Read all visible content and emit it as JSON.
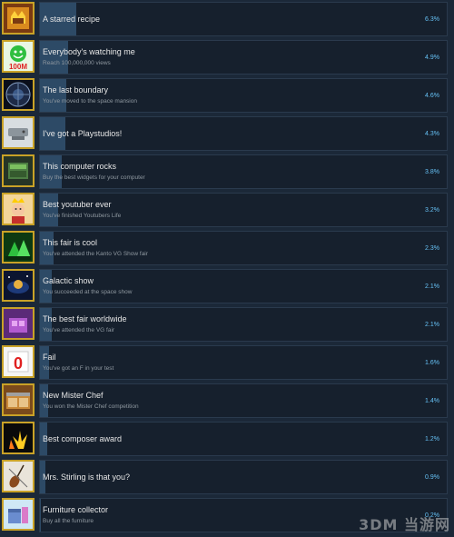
{
  "achievements": [
    {
      "title": "A starred recipe",
      "desc": "",
      "percent": "6.3%",
      "value": 6.3,
      "icon": "crown-chef-icon"
    },
    {
      "title": "Everybody's watching me",
      "desc": "Reach 100,000,000 views",
      "percent": "4.9%",
      "value": 4.9,
      "icon": "100m-smiley-icon",
      "icon_text": "100M"
    },
    {
      "title": "The last boundary",
      "desc": "You've moved to the space mansion",
      "percent": "4.6%",
      "value": 4.6,
      "icon": "space-mansion-icon"
    },
    {
      "title": "I've got a Playstudios!",
      "desc": "",
      "percent": "4.3%",
      "value": 4.3,
      "icon": "console-icon"
    },
    {
      "title": "This computer rocks",
      "desc": "Buy the best widgets for your computer",
      "percent": "3.8%",
      "value": 3.8,
      "icon": "computer-case-icon"
    },
    {
      "title": "Best youtuber ever",
      "desc": "You've finished Youtubers Life",
      "percent": "3.2%",
      "value": 3.2,
      "icon": "crowned-youtuber-icon"
    },
    {
      "title": "This fair is cool",
      "desc": "You've attended the Kanto VG Show fair",
      "percent": "2.3%",
      "value": 2.3,
      "icon": "green-fair-icon"
    },
    {
      "title": "Galactic show",
      "desc": "You succeeded at the space show",
      "percent": "2.1%",
      "value": 2.1,
      "icon": "galactic-stage-icon"
    },
    {
      "title": "The best fair worldwide",
      "desc": "You've attended the VG fair",
      "percent": "2.1%",
      "value": 2.1,
      "icon": "purple-fair-icon"
    },
    {
      "title": "Fail",
      "desc": "You've got an F in your test",
      "percent": "1.6%",
      "value": 1.6,
      "icon": "zero-grade-icon",
      "icon_text": "0"
    },
    {
      "title": "New Mister Chef",
      "desc": "You won the Mister Chef competition",
      "percent": "1.4%",
      "value": 1.4,
      "icon": "kitchen-icon"
    },
    {
      "title": "Best composer award",
      "desc": "",
      "percent": "1.2%",
      "value": 1.2,
      "icon": "fireworks-icon"
    },
    {
      "title": "Mrs. Stirling is that you?",
      "desc": "",
      "percent": "0.9%",
      "value": 0.9,
      "icon": "violin-icon"
    },
    {
      "title": "Furniture collector",
      "desc": "Buy all the furniture",
      "percent": "0.2%",
      "value": 0.2,
      "icon": "furniture-icon"
    }
  ],
  "watermark": "3DM 当游网"
}
